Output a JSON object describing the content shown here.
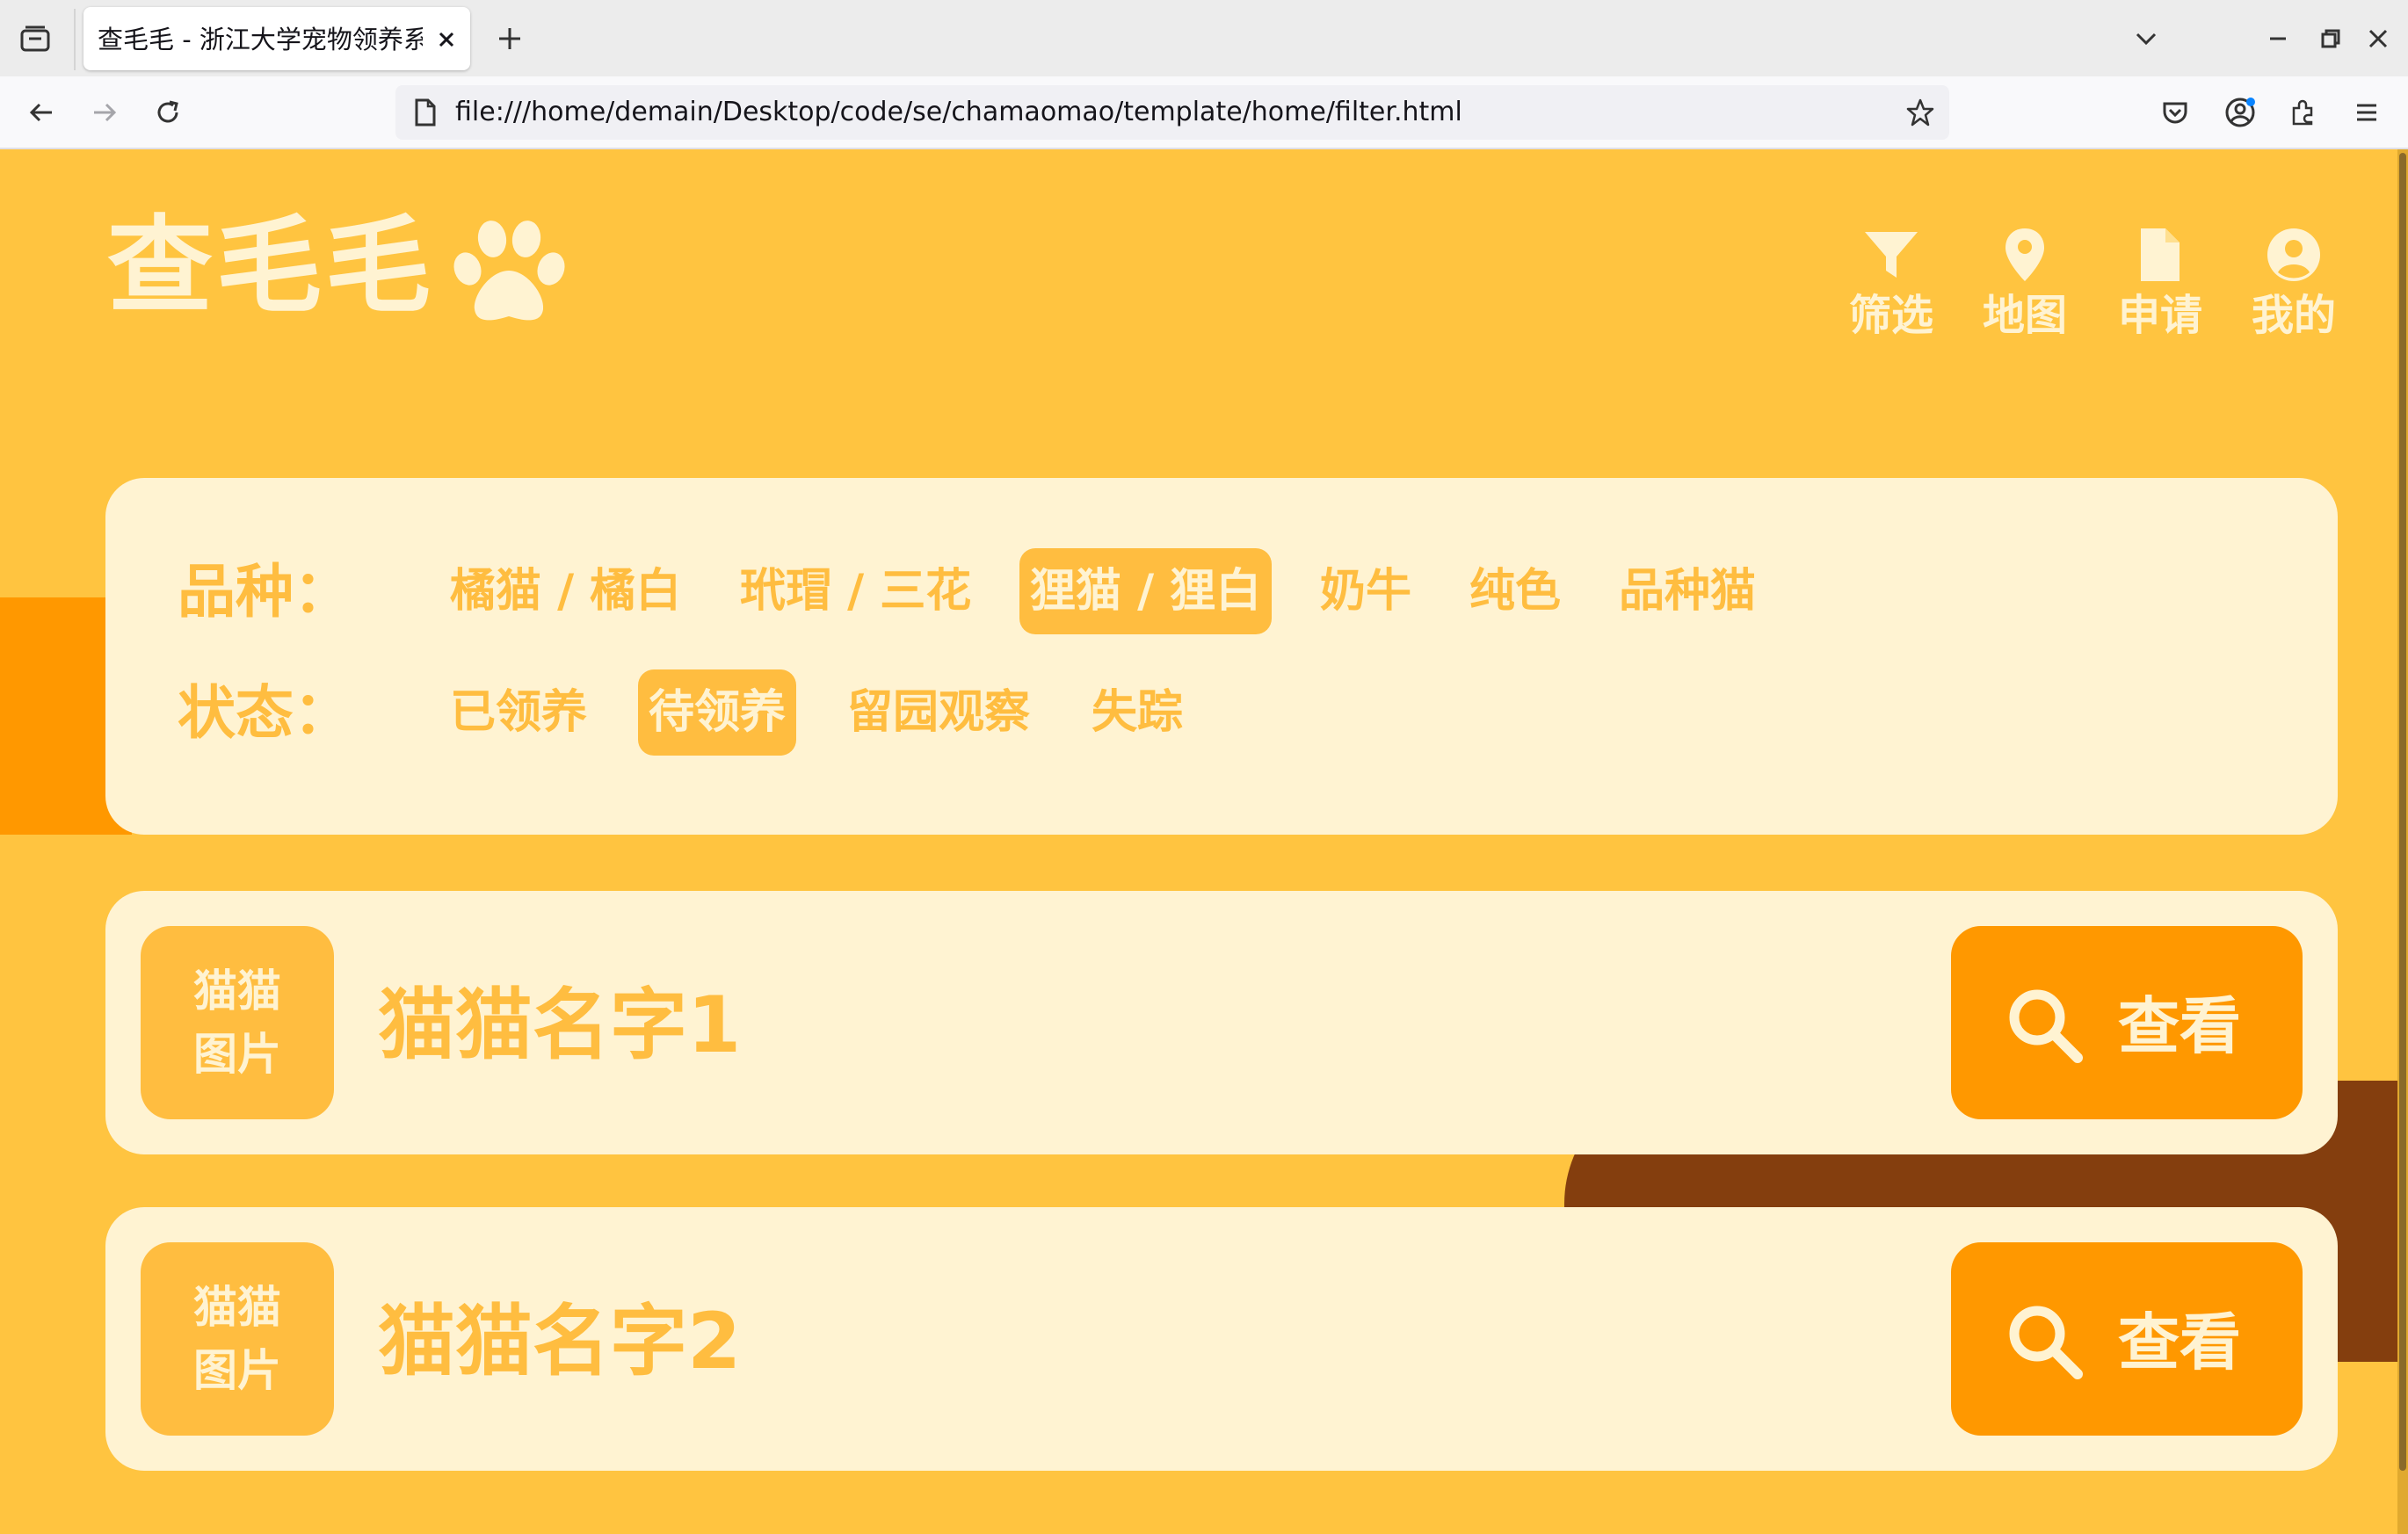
{
  "browser": {
    "tab_title": "查毛毛 - 浙江大学宠物领养系统",
    "url": "file:///home/demain/Desktop/code/se/chamaomao/template/home/filter.html"
  },
  "colors": {
    "page_bg": "#ffc440",
    "card_bg": "#fff3d2",
    "accent": "#ffbd40",
    "button_bg": "#ff9800",
    "deco_brown": "#843e0e"
  },
  "header": {
    "logo_text": "查毛毛",
    "logo_icon": "paw-icon",
    "nav": [
      {
        "label": "筛选",
        "icon": "filter-icon"
      },
      {
        "label": "地图",
        "icon": "map-pin-icon"
      },
      {
        "label": "申请",
        "icon": "document-icon"
      },
      {
        "label": "我的",
        "icon": "user-circle-icon"
      }
    ]
  },
  "filters": {
    "breed": {
      "label": "品种：",
      "options": [
        "橘猫 / 橘白",
        "玳瑁 / 三花",
        "狸猫 / 狸白",
        "奶牛",
        "纯色",
        "品种猫"
      ],
      "selected": "狸猫 / 狸白"
    },
    "status": {
      "label": "状态：",
      "options": [
        "已领养",
        "待领养",
        "留园观察",
        "失踪"
      ],
      "selected": "待领养"
    }
  },
  "cats": [
    {
      "image_placeholder": "猫猫图片",
      "name": "猫猫名字1",
      "button_label": "查看"
    },
    {
      "image_placeholder": "猫猫图片",
      "name": "猫猫名字2",
      "button_label": "查看"
    }
  ]
}
